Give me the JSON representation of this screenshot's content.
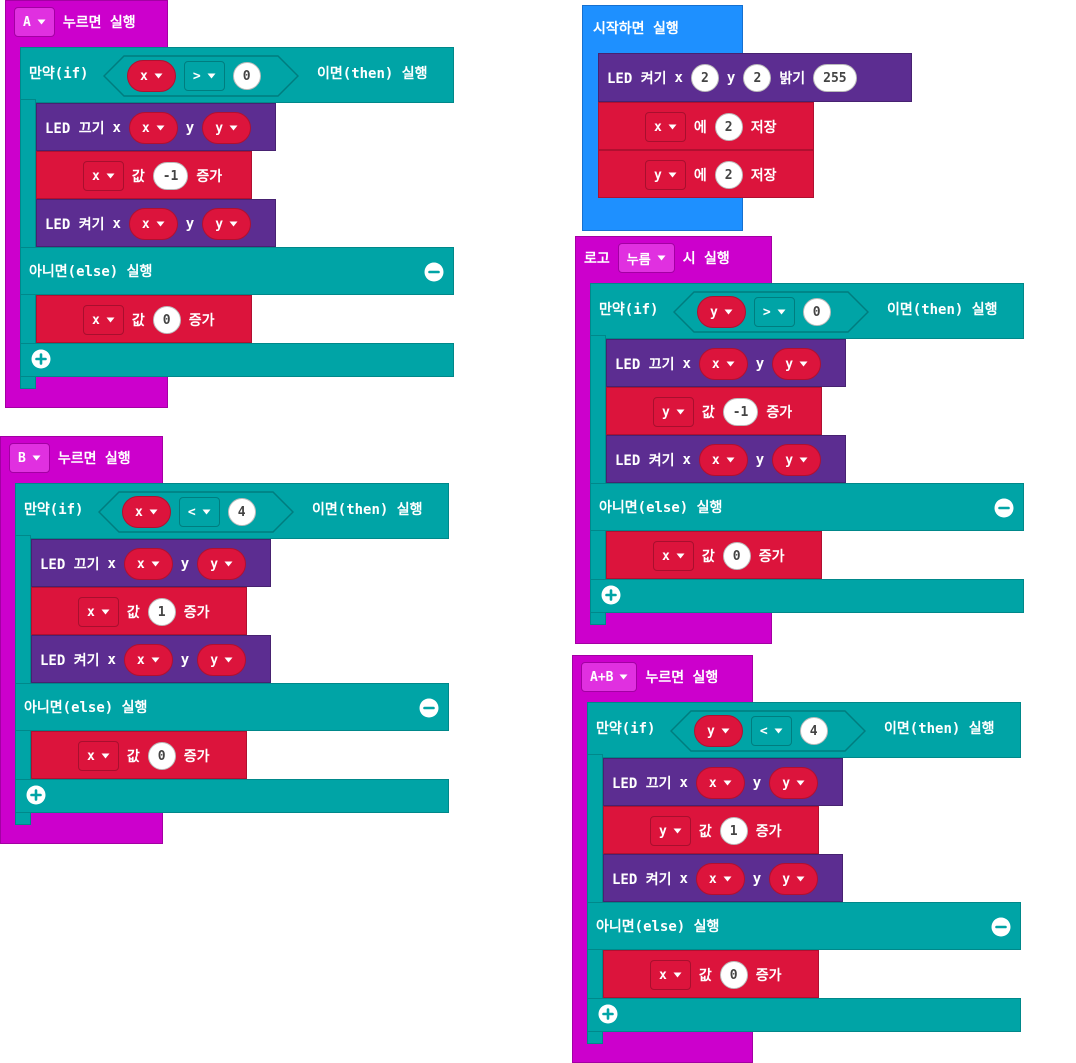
{
  "blocks": {
    "on_a": {
      "button": "A",
      "label": "누르면 실행",
      "if_label": "만약(if)",
      "var": "x",
      "op": ">",
      "value": "0",
      "then_label": "이면(then) 실행",
      "led_off": {
        "label": "LED 끄기",
        "x_label": "x",
        "x": "x",
        "y_label": "y",
        "y": "y"
      },
      "change": {
        "var": "x",
        "label": "값",
        "value": "-1",
        "suffix": "증가"
      },
      "led_on": {
        "label": "LED 켜기",
        "x_label": "x",
        "x": "x",
        "y_label": "y",
        "y": "y"
      },
      "else_label": "아니면(else) 실행",
      "else_change": {
        "var": "x",
        "label": "값",
        "value": "0",
        "suffix": "증가"
      }
    },
    "on_b": {
      "button": "B",
      "label": "누르면 실행",
      "if_label": "만약(if)",
      "var": "x",
      "op": "<",
      "value": "4",
      "then_label": "이면(then) 실행",
      "led_off": {
        "label": "LED 끄기",
        "x_label": "x",
        "x": "x",
        "y_label": "y",
        "y": "y"
      },
      "change": {
        "var": "x",
        "label": "값",
        "value": "1",
        "suffix": "증가"
      },
      "led_on": {
        "label": "LED 켜기",
        "x_label": "x",
        "x": "x",
        "y_label": "y",
        "y": "y"
      },
      "else_label": "아니면(else) 실행",
      "else_change": {
        "var": "x",
        "label": "값",
        "value": "0",
        "suffix": "증가"
      }
    },
    "on_start": {
      "label": "시작하면 실행",
      "plot": {
        "label": "LED 켜기",
        "x_label": "x",
        "x": "2",
        "y_label": "y",
        "y": "2",
        "b_label": "밝기",
        "b": "255"
      },
      "set_x": {
        "var": "x",
        "label": "에",
        "value": "2",
        "suffix": "저장"
      },
      "set_y": {
        "var": "y",
        "label": "에",
        "value": "2",
        "suffix": "저장"
      }
    },
    "on_logo": {
      "prefix": "로고",
      "event": "누름",
      "label": "시 실행",
      "if_label": "만약(if)",
      "var": "y",
      "op": ">",
      "value": "0",
      "then_label": "이면(then) 실행",
      "led_off": {
        "label": "LED 끄기",
        "x_label": "x",
        "x": "x",
        "y_label": "y",
        "y": "y"
      },
      "change": {
        "var": "y",
        "label": "값",
        "value": "-1",
        "suffix": "증가"
      },
      "led_on": {
        "label": "LED 켜기",
        "x_label": "x",
        "x": "x",
        "y_label": "y",
        "y": "y"
      },
      "else_label": "아니면(else) 실행",
      "else_change": {
        "var": "x",
        "label": "값",
        "value": "0",
        "suffix": "증가"
      }
    },
    "on_ab": {
      "button": "A+B",
      "label": "누르면 실행",
      "if_label": "만약(if)",
      "var": "y",
      "op": "<",
      "value": "4",
      "then_label": "이면(then) 실행",
      "led_off": {
        "label": "LED 끄기",
        "x_label": "x",
        "x": "x",
        "y_label": "y",
        "y": "y"
      },
      "change": {
        "var": "y",
        "label": "값",
        "value": "1",
        "suffix": "증가"
      },
      "led_on": {
        "label": "LED 켜기",
        "x_label": "x",
        "x": "x",
        "y_label": "y",
        "y": "y"
      },
      "else_label": "아니면(else) 실행",
      "else_change": {
        "var": "x",
        "label": "값",
        "value": "0",
        "suffix": "증가"
      }
    }
  },
  "icons": {
    "dropdown": "caret-down-icon",
    "remove": "minus-circle-icon",
    "add": "plus-circle-icon"
  },
  "colors": {
    "event": "#cc00cc",
    "start": "#1e90ff",
    "logic": "#00a4a6",
    "led": "#5c2d91",
    "variables": "#dc143c"
  }
}
